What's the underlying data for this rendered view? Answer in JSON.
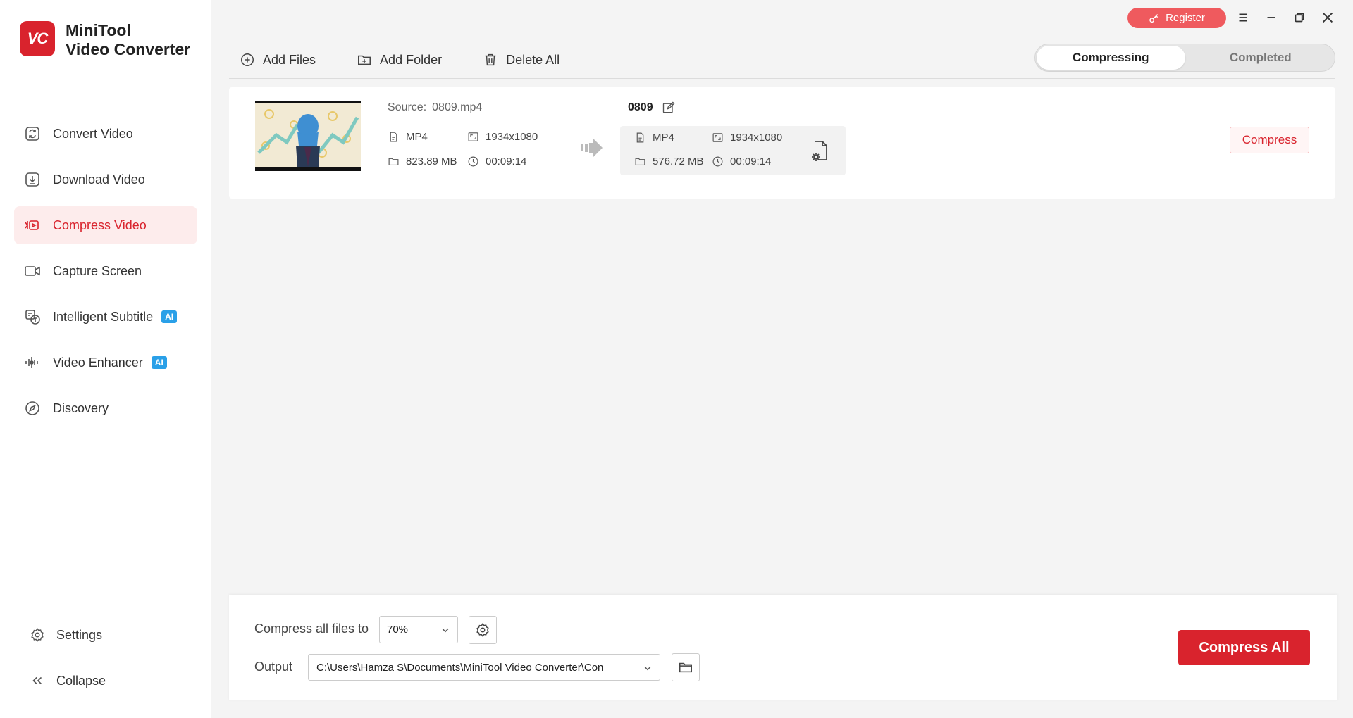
{
  "app": {
    "logo_text": "VC",
    "title_line1": "MiniTool",
    "title_line2": "Video Converter"
  },
  "sidebar": {
    "items": [
      {
        "label": "Convert Video",
        "icon": "convert-icon"
      },
      {
        "label": "Download Video",
        "icon": "download-icon"
      },
      {
        "label": "Compress Video",
        "icon": "compress-icon",
        "active": true
      },
      {
        "label": "Capture Screen",
        "icon": "camera-icon"
      },
      {
        "label": "Intelligent Subtitle",
        "icon": "subtitle-icon",
        "badge": "AI"
      },
      {
        "label": "Video Enhancer",
        "icon": "waveform-icon",
        "badge": "AI"
      },
      {
        "label": "Discovery",
        "icon": "compass-icon"
      }
    ],
    "settings_label": "Settings",
    "collapse_label": "Collapse"
  },
  "titlebar": {
    "register_label": "Register"
  },
  "toolbar": {
    "add_files": "Add Files",
    "add_folder": "Add Folder",
    "delete_all": "Delete All"
  },
  "tabs": {
    "compressing": "Compressing",
    "completed": "Completed",
    "active": "compressing"
  },
  "file": {
    "source_label": "Source:",
    "source_name": "0809.mp4",
    "source_format": "MP4",
    "source_resolution": "1934x1080",
    "source_size": "823.89 MB",
    "source_duration": "00:09:14",
    "output_name": "0809",
    "output_format": "MP4",
    "output_resolution": "1934x1080",
    "output_size": "576.72 MB",
    "output_duration": "00:09:14",
    "compress_label": "Compress"
  },
  "bottom": {
    "compress_all_label": "Compress all files to",
    "compress_ratio": "70%",
    "output_label": "Output",
    "output_path": "C:\\Users\\Hamza S\\Documents\\MiniTool Video Converter\\Con",
    "compress_all_button": "Compress All"
  },
  "colors": {
    "accent": "#d9232d",
    "register": "#ef5a5e",
    "ai_badge": "#2aa0e8",
    "active_bg": "#fdecec"
  }
}
